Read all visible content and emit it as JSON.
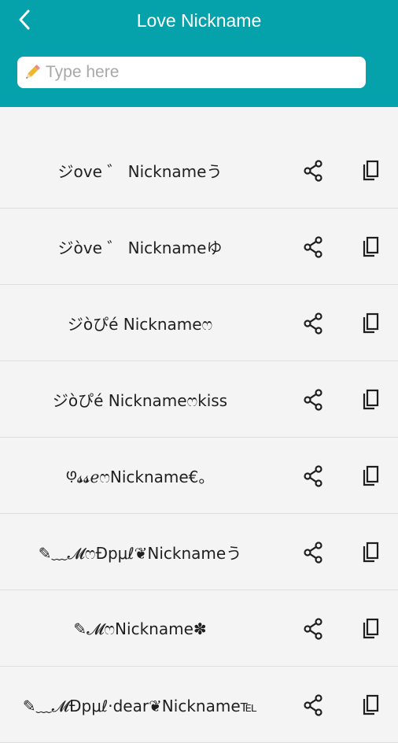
{
  "header": {
    "title": "Love Nickname",
    "back_icon": "back-arrow-icon",
    "background": "#05a2ab"
  },
  "search": {
    "placeholder": "Type here",
    "value": "",
    "icon": "pencil-icon"
  },
  "nicknames": [
    "ジove ゛ Nicknameう",
    "ジòve ゛ Nicknameゆ",
    "ジòぴé Nicknameෆ",
    "ジòぴé Nicknameෆkiss",
    "ꚩ𝓼𝓼ℯෆNickname€。",
    "✎﹏𝓜ෆĐpμℓ❦Nicknameう",
    "✎𝓜ෆNickname✽",
    "✎﹏𝓜Đpμℓ·dear❦Nickname℡"
  ],
  "row_actions": {
    "share_icon": "share-icon",
    "copy_icon": "copy-icon"
  }
}
